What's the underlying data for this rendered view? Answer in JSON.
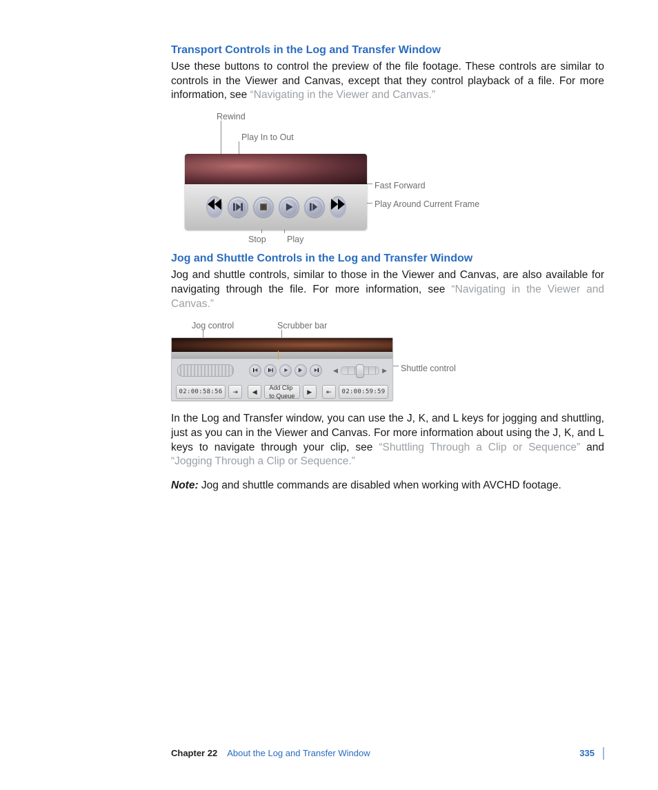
{
  "section1": {
    "heading": "Transport Controls in the Log and Transfer Window",
    "para_a": "Use these buttons to control the preview of the file footage. These controls are similar to controls in the Viewer and Canvas, except that they control playback of a file. For more information, see ",
    "para_link": "“Navigating in the Viewer and Canvas.”"
  },
  "fig1_labels": {
    "rewind": "Rewind",
    "play_in_out": "Play In to Out",
    "fast_forward": "Fast Forward",
    "play_around": "Play Around Current Frame",
    "stop": "Stop",
    "play": "Play"
  },
  "section2": {
    "heading": "Jog and Shuttle Controls in the Log and Transfer Window",
    "para_a": "Jog and shuttle controls, similar to those in the Viewer and Canvas, are also available for navigating through the file. For more information, see ",
    "para_link": "“Navigating in the Viewer and Canvas.”"
  },
  "fig2_labels": {
    "jog": "Jog control",
    "scrubber": "Scrubber bar",
    "shuttle": "Shuttle control"
  },
  "fig2_ui": {
    "tc_in": "02:00:58:56",
    "tc_out": "02:00:59:59",
    "add_clip": "Add Clip to Queue"
  },
  "para3_a": "In the Log and Transfer window, you can use the J, K, and L keys for jogging and shuttling, just as you can in the Viewer and Canvas. For more information about using the J, K, and L keys to navigate through your clip, see ",
  "para3_link1": "“Shuttling Through a Clip or Sequence”",
  "para3_mid": " and ",
  "para3_link2": "“Jogging Through a Clip or Sequence.”",
  "note_label": "Note:",
  "note_text": "  Jog and shuttle commands are disabled when working with AVCHD footage.",
  "footer": {
    "chapter": "Chapter 22",
    "title": "About the Log and Transfer Window",
    "page": "335"
  }
}
